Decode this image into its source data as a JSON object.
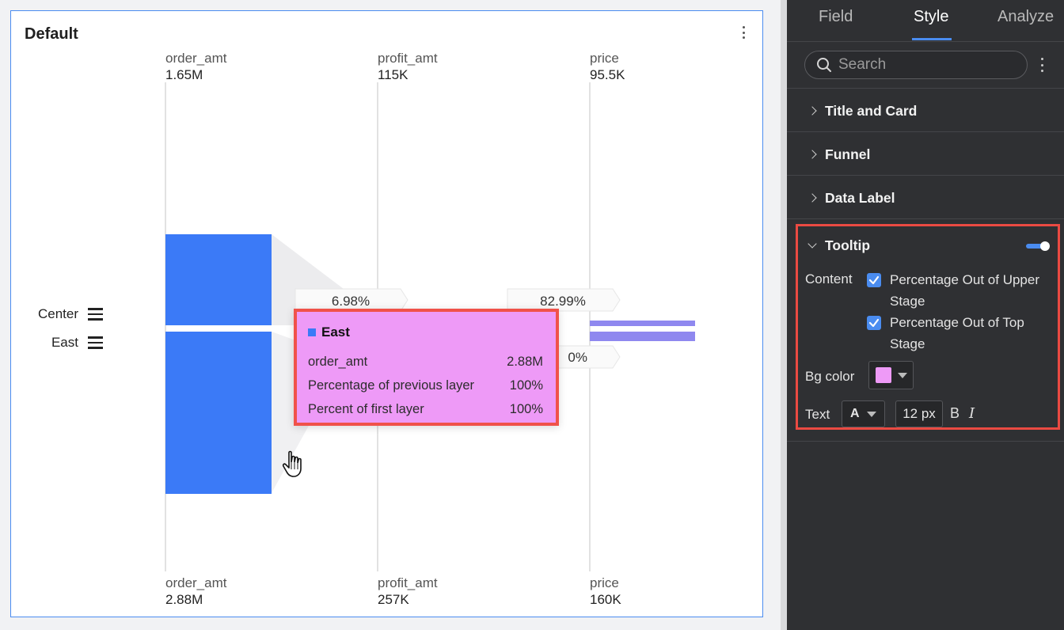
{
  "card": {
    "title": "Default"
  },
  "legend": [
    {
      "label": "Center"
    },
    {
      "label": "East"
    }
  ],
  "colors": {
    "series_east": "#3b7af7",
    "series_center": "#8f88ef",
    "tooltip_bg": "#ee9af7",
    "highlight_border": "#f0524a",
    "accent": "#4a8cf0"
  },
  "chart_data": {
    "type": "funnel",
    "stages": [
      "order_amt",
      "profit_amt",
      "price"
    ],
    "series": [
      {
        "name": "Center",
        "values": [
          1650000,
          115000,
          95500
        ],
        "value_labels": [
          "1.65M",
          "115K",
          "95.5K"
        ],
        "conversion_labels": [
          "6.98%",
          "82.99%"
        ]
      },
      {
        "name": "East",
        "values": [
          2880000,
          257000,
          160000
        ],
        "value_labels": [
          "2.88M",
          "257K",
          "160K"
        ],
        "conversion_labels": [
          "",
          "0%"
        ]
      }
    ],
    "stage_labels_top": [
      "order_amt",
      "profit_amt",
      "price"
    ],
    "stage_labels_bottom": [
      "order_amt",
      "profit_amt",
      "price"
    ]
  },
  "tooltip": {
    "title": "East",
    "rows": [
      {
        "label": "order_amt",
        "value": "2.88M"
      },
      {
        "label": "Percentage of previous layer",
        "value": "100%"
      },
      {
        "label": "Percent of first layer",
        "value": "100%"
      }
    ]
  },
  "panel": {
    "tabs": [
      {
        "label": "Field"
      },
      {
        "label": "Style"
      },
      {
        "label": "Analyze"
      }
    ],
    "active_tab": "Style",
    "search_placeholder": "Search",
    "sections": [
      {
        "label": "Title and Card"
      },
      {
        "label": "Funnel"
      },
      {
        "label": "Data Label"
      }
    ],
    "tooltip_section": {
      "label": "Tooltip",
      "enabled": true,
      "content_label": "Content",
      "options": [
        {
          "label": "Percentage Out of Upper Stage",
          "checked": true
        },
        {
          "label": "Percentage Out of Top Stage",
          "checked": true
        }
      ],
      "bg_color_label": "Bg color",
      "bg_color": "#ee9af7",
      "text_label": "Text",
      "font_glyph": "A",
      "font_size": "12 px",
      "bold_glyph": "B",
      "italic_glyph": "I"
    }
  }
}
